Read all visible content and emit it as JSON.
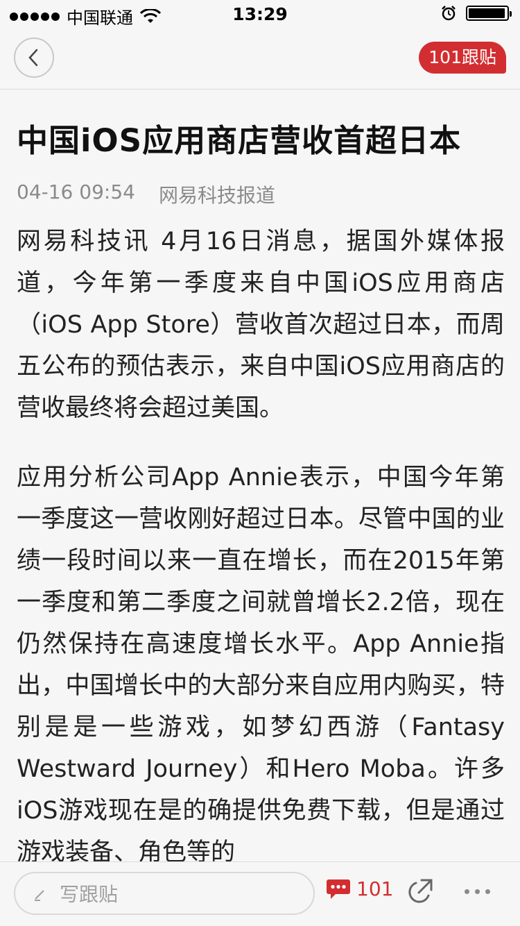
{
  "status_bar": {
    "carrier": "中国联通",
    "time": "13:29"
  },
  "nav": {
    "comment_badge": "101跟贴"
  },
  "article": {
    "title": "中国iOS应用商店营收首超日本",
    "date": "04-16 09:54",
    "source": "网易科技报道",
    "paragraphs": [
      "网易科技讯 4月16日消息，据国外媒体报道，今年第一季度来自中国iOS应用商店（iOS App Store）营收首次超过日本，而周五公布的预估表示，来自中国iOS应用商店的营收最终将会超过美国。",
      "应用分析公司App Annie表示，中国今年第一季度这一营收刚好超过日本。尽管中国的业绩一段时间以来一直在增长，而在2015年第一季度和第二季度之间就曾增长2.2倍，现在仍然保持在高速度增长水平。App Annie指出，中国增长中的大部分来自应用内购买，特别是是一些游戏，如梦幻西游（Fantasy Westward Journey）和Hero Moba。许多iOS游戏现在是的确提供免费下载，但是通过游戏装备、角色等的"
    ]
  },
  "bottom_bar": {
    "comment_placeholder": "写跟贴",
    "comments_count": "101"
  },
  "colors": {
    "accent": "#d22e31",
    "background": "#f6f6f6"
  }
}
